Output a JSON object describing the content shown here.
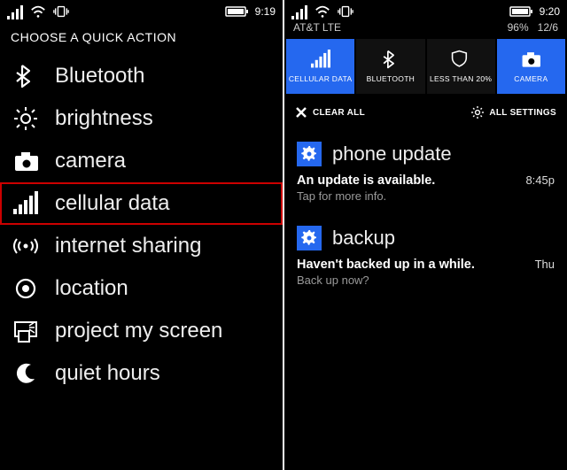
{
  "left": {
    "status": {
      "time": "9:19"
    },
    "title": "CHOOSE A QUICK ACTION",
    "items": [
      {
        "icon": "bluetooth",
        "label": "Bluetooth",
        "highlight": false
      },
      {
        "icon": "brightness",
        "label": "brightness",
        "highlight": false
      },
      {
        "icon": "camera",
        "label": "camera",
        "highlight": false
      },
      {
        "icon": "cellular",
        "label": "cellular data",
        "highlight": true
      },
      {
        "icon": "internet-sharing",
        "label": "internet sharing",
        "highlight": false
      },
      {
        "icon": "location",
        "label": "location",
        "highlight": false
      },
      {
        "icon": "project",
        "label": "project my screen",
        "highlight": false
      },
      {
        "icon": "quiet-hours",
        "label": "quiet hours",
        "highlight": false
      }
    ]
  },
  "right": {
    "status": {
      "time": "9:20",
      "carrier": "AT&T LTE",
      "battery_pct": "96%",
      "date": "12/6"
    },
    "tiles": [
      {
        "icon": "cellular",
        "label": "CELLULAR DATA",
        "active": true
      },
      {
        "icon": "bluetooth",
        "label": "BLUETOOTH",
        "active": false
      },
      {
        "icon": "shield",
        "label": "LESS THAN 20%",
        "active": false
      },
      {
        "icon": "camera",
        "label": "CAMERA",
        "active": true
      }
    ],
    "clear_all": "CLEAR ALL",
    "all_settings": "ALL SETTINGS",
    "notifications": [
      {
        "title": "phone update",
        "headline": "An update is available.",
        "sub": "Tap for more info.",
        "time": "8:45p"
      },
      {
        "title": "backup",
        "headline": "Haven't backed up in a while.",
        "sub": "Back up now?",
        "time": "Thu"
      }
    ]
  }
}
